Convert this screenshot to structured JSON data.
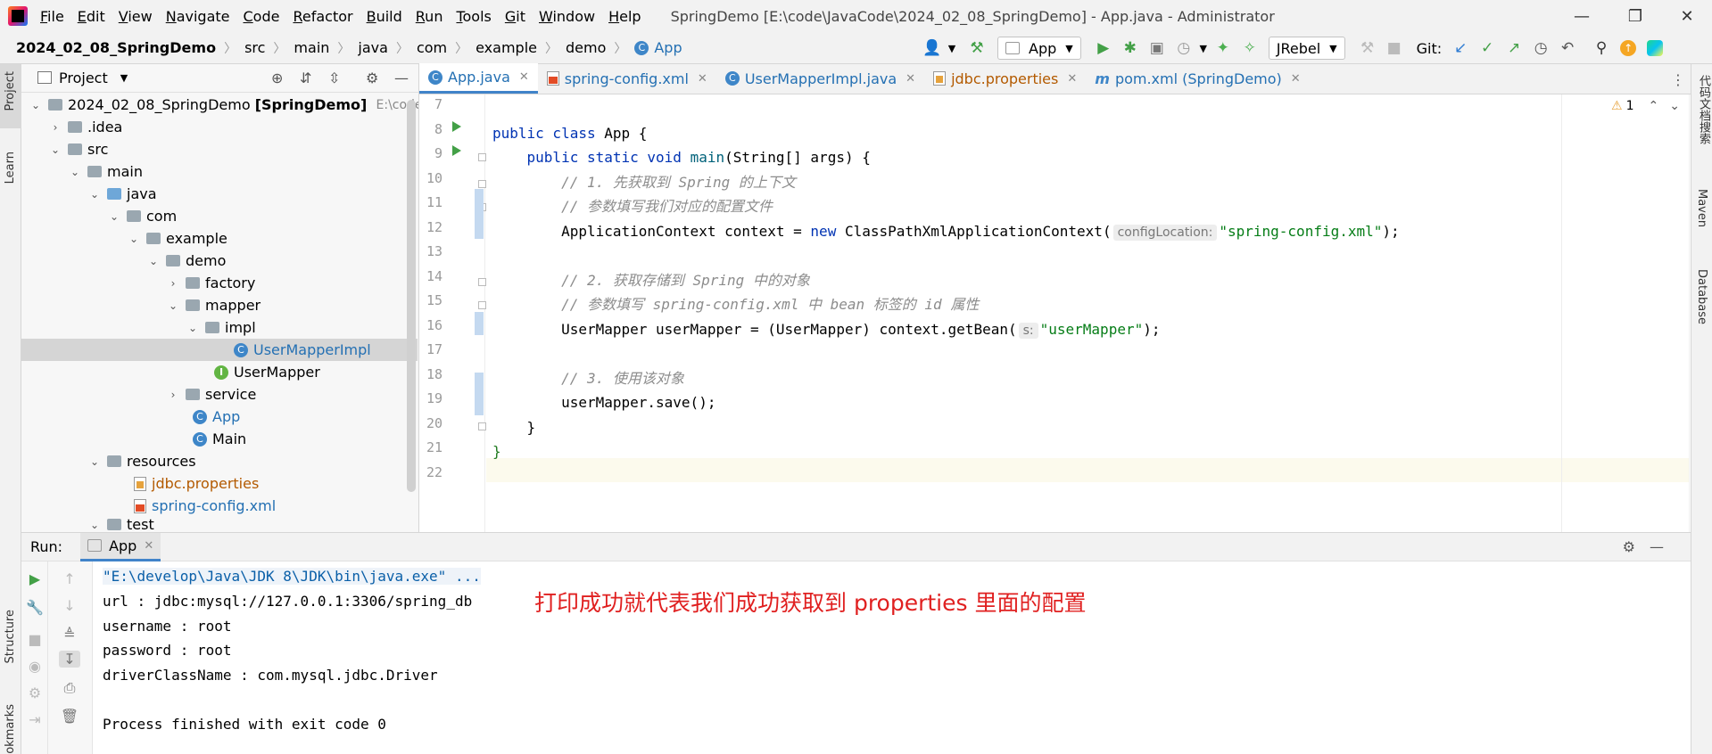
{
  "menubar": {
    "items": [
      {
        "label": "File",
        "key": "F",
        "rest": "ile"
      },
      {
        "label": "Edit",
        "key": "E",
        "rest": "dit"
      },
      {
        "label": "View",
        "key": "V",
        "rest": "iew"
      },
      {
        "label": "Navigate",
        "key": "N",
        "rest": "avigate"
      },
      {
        "label": "Code",
        "key": "C",
        "rest": "ode"
      },
      {
        "label": "Refactor",
        "key": "R",
        "rest": "efactor"
      },
      {
        "label": "Build",
        "key": "B",
        "rest": "uild"
      },
      {
        "label": "Run",
        "key": "R",
        "rest": "un"
      },
      {
        "label": "Tools",
        "key": "T",
        "rest": "ools"
      },
      {
        "label": "Git",
        "key": "G",
        "rest": "it"
      },
      {
        "label": "Window",
        "key": "W",
        "rest": "indow"
      },
      {
        "label": "Help",
        "key": "H",
        "rest": "elp"
      }
    ],
    "window_title": "SpringDemo [E:\\code\\JavaCode\\2024_02_08_SpringDemo] - App.java - Administrator"
  },
  "navbar": {
    "crumbs": [
      "2024_02_08_SpringDemo",
      "src",
      "main",
      "java",
      "com",
      "example",
      "demo",
      "App"
    ],
    "run_config": "App",
    "jrebel": "JRebel",
    "git_label": "Git:"
  },
  "project_panel": {
    "title": "Project",
    "tree": [
      {
        "label": "2024_02_08_SpringDemo",
        "bold_suffix": "[SpringDemo]",
        "hint": "E:\\code\\Java"
      },
      {
        "label": ".idea"
      },
      {
        "label": "src"
      },
      {
        "label": "main"
      },
      {
        "label": "java"
      },
      {
        "label": "com"
      },
      {
        "label": "example"
      },
      {
        "label": "demo"
      },
      {
        "label": "factory"
      },
      {
        "label": "mapper"
      },
      {
        "label": "impl"
      },
      {
        "label": "UserMapperImpl"
      },
      {
        "label": "UserMapper"
      },
      {
        "label": "service"
      },
      {
        "label": "App"
      },
      {
        "label": "Main"
      },
      {
        "label": "resources"
      },
      {
        "label": "jdbc.properties"
      },
      {
        "label": "spring-config.xml"
      },
      {
        "label": "test"
      }
    ]
  },
  "tabs": [
    {
      "label": "App.java"
    },
    {
      "label": "spring-config.xml"
    },
    {
      "label": "UserMapperImpl.java"
    },
    {
      "label": "jdbc.properties"
    },
    {
      "label": "pom.xml (SpringDemo)"
    }
  ],
  "editor": {
    "warning_count": "1",
    "line_numbers": [
      "7",
      "8",
      "9",
      "10",
      "11",
      "12",
      "13",
      "14",
      "15",
      "16",
      "17",
      "18",
      "19",
      "20",
      "21",
      "22"
    ],
    "lines": {
      "l8_kw": "public class ",
      "l8_name": "App {",
      "l9_kw": "public static void ",
      "l9_fn": "main",
      "l9_rest": "(String[] args) {",
      "l10": "// 1. 先获取到 Spring 的上下文",
      "l11": "// 参数填写我们对应的配置文件",
      "l12_a": "ApplicationContext context = ",
      "l12_new": "new ",
      "l12_b": "ClassPathXmlApplicationContext(",
      "l12_hint": "configLocation:",
      "l12_str": "\"spring-config.xml\"",
      "l12_end": ");",
      "l14": "// 2. 获取存储到 Spring 中的对象",
      "l15": "// 参数填写 spring-config.xml 中 bean 标签的 id 属性",
      "l16_a": "UserMapper userMapper = (UserMapper) context.getBean(",
      "l16_hint": "s:",
      "l16_str": "\"userMapper\"",
      "l16_end": ");",
      "l18": "// 3. 使用该对象",
      "l19": "userMapper.save();",
      "l20": "}",
      "l21": "}"
    }
  },
  "run_panel": {
    "label": "Run:",
    "tab": "App",
    "output": [
      "\"E:\\develop\\Java\\JDK 8\\JDK\\bin\\java.exe\" ...",
      "url : jdbc:mysql://127.0.0.1:3306/spring_db",
      "username : root",
      "password : root",
      "driverClassName : com.mysql.jdbc.Driver",
      "",
      "Process finished with exit code 0"
    ]
  },
  "annotation": "打印成功就代表我们成功获取到 properties 里面的配置",
  "left_strip": {
    "project": "Project",
    "learn": "Learn",
    "structure": "Structure",
    "bookmarks": "Bookmarks"
  },
  "right_strip": {
    "doc": "代码文档搜索",
    "maven": "Maven",
    "database": "Database"
  }
}
